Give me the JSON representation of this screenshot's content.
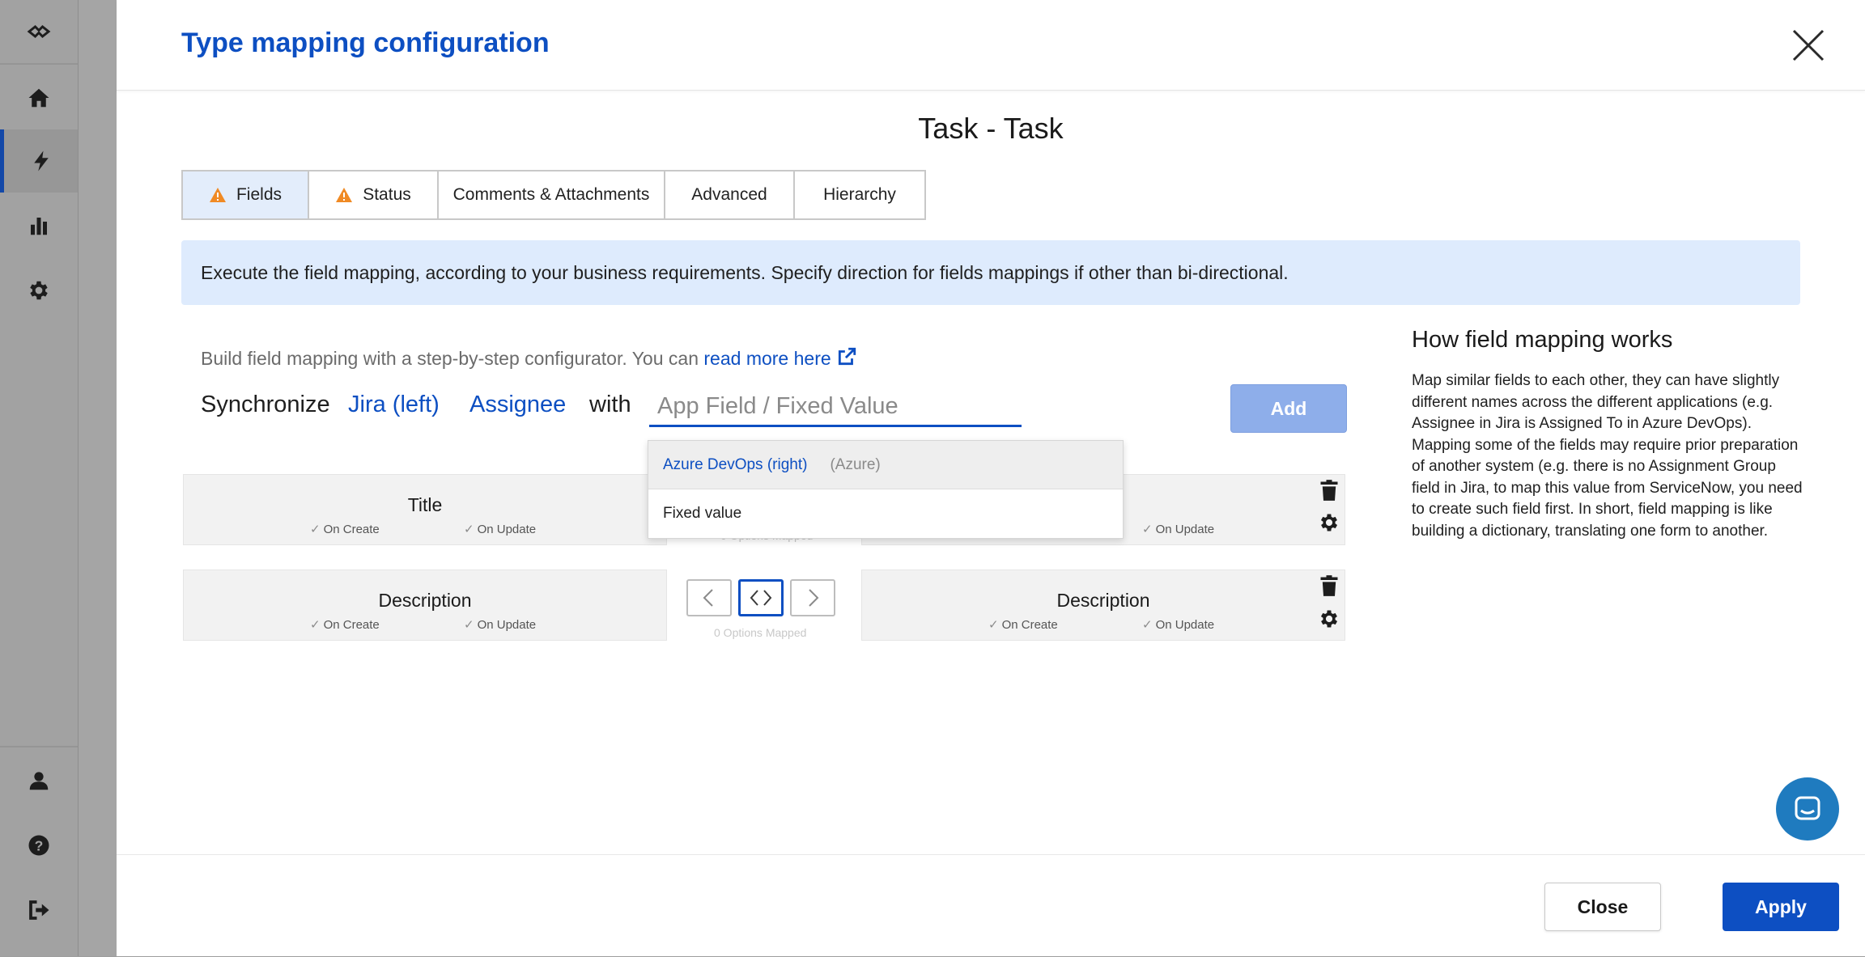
{
  "modal": {
    "title": "Type mapping configuration",
    "subtitle": "Task - Task"
  },
  "tabs": [
    {
      "label": "Fields",
      "warning": true,
      "active": true
    },
    {
      "label": "Status",
      "warning": true,
      "active": false
    },
    {
      "label": "Comments & Attachments",
      "warning": false,
      "active": false
    },
    {
      "label": "Advanced",
      "warning": false,
      "active": false
    },
    {
      "label": "Hierarchy",
      "warning": false,
      "active": false
    }
  ],
  "info": "Execute the field mapping, according to your business requirements. Specify direction for fields mappings if other than bi-directional.",
  "builder": {
    "hint": "Build field mapping with a step-by-step configurator. You can ",
    "read_more": "read more here",
    "synchronize": "Synchronize",
    "side": "Jira (left)",
    "field": "Assignee",
    "with": "with",
    "target_placeholder": "App Field / Fixed Value",
    "add_label": "Add"
  },
  "dropdown": {
    "items": [
      {
        "label": "Azure DevOps (right)",
        "sub": "(Azure)"
      },
      {
        "label": "Fixed value",
        "sub": ""
      }
    ]
  },
  "mappings": [
    {
      "left": "Title",
      "right": "",
      "on_create": "On Create",
      "on_update": "On Update",
      "options": "0 Options Mapped"
    },
    {
      "left": "Description",
      "right": "Description",
      "on_create": "On Create",
      "on_update": "On Update",
      "options": "0 Options Mapped"
    }
  ],
  "help": {
    "title": "How field mapping works",
    "text": "Map similar fields to each other, they can have slightly different names across the different applications (e.g. Assignee in Jira is Assigned To in Azure DevOps). Mapping some of the fields may require prior preparation of another system (e.g. there is no Assignment Group field in Jira, to map this value from ServiceNow, you need to create such field first. In short, field mapping is like building a dictionary, translating one form to another."
  },
  "footer": {
    "close_label": "Close",
    "apply_label": "Apply"
  },
  "colors": {
    "accent": "#0d4fc2",
    "warning": "#f08a24",
    "info_bg": "#deebfd"
  }
}
